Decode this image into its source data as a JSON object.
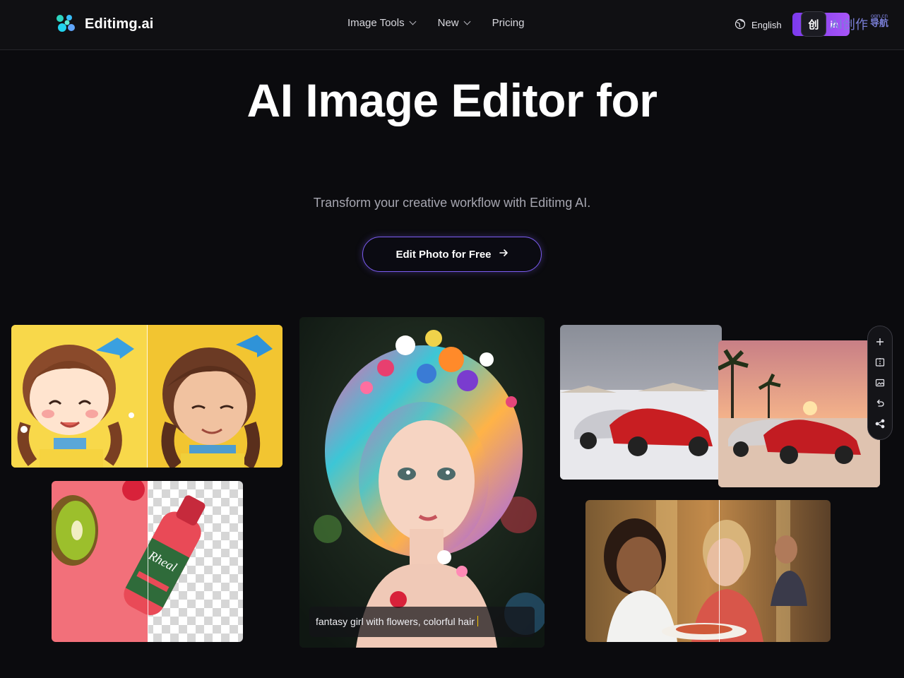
{
  "header": {
    "brand": "Editimg.ai",
    "nav": [
      {
        "label": "Image Tools",
        "has_dropdown": true
      },
      {
        "label": "New",
        "has_dropdown": true
      },
      {
        "label": "Pricing",
        "has_dropdown": false
      }
    ],
    "language": "English",
    "signin_label": "in"
  },
  "watermark": {
    "icon_text": "创",
    "text": "AI创作",
    "sub_top": "ogn.cn",
    "sub_bottom": "导航"
  },
  "hero": {
    "title": "AI Image Editor for",
    "subtitle": "Transform your creative workflow with Editimg AI.",
    "cta_label": "Edit Photo for Free"
  },
  "gallery": {
    "caption": "fantasy girl with flowers, colorful hair",
    "toolbar": [
      "plus-icon",
      "compare-icon",
      "image-icon",
      "undo-icon",
      "share-icon"
    ]
  },
  "colors": {
    "background": "#0b0b0e",
    "accent": "#7c3aed",
    "accent_light": "#a855f7",
    "cta_border": "#7b5cf0"
  }
}
